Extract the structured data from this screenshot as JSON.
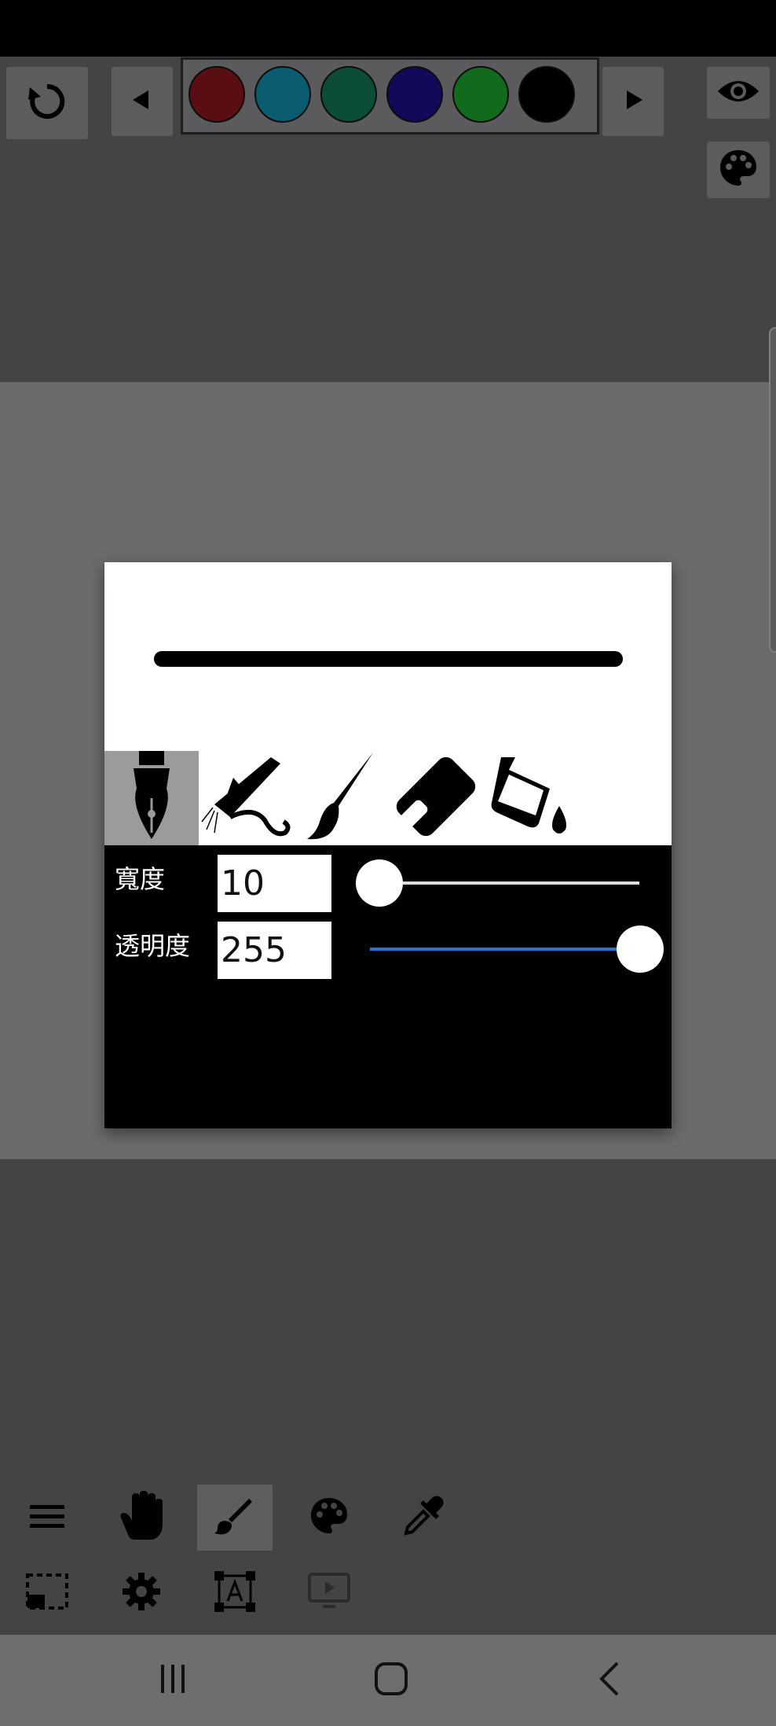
{
  "colors": {
    "status_bar": "#000000",
    "background": "#454346",
    "canvas": "#6b6a6d",
    "accent": "#1f74e0"
  },
  "palette": {
    "swatches": [
      "#5a0d12",
      "#0a5c70",
      "#0b4d38",
      "#12085a",
      "#126a1c",
      "#000000"
    ]
  },
  "top_toolbar": {
    "undo_icon": "undo-icon",
    "prev_icon": "triangle-left-icon",
    "next_icon": "triangle-right-icon",
    "visibility_icon": "eye-icon",
    "palette_icon": "palette-icon"
  },
  "brush_dialog": {
    "tools": [
      {
        "name": "fountain-pen-icon",
        "selected": true
      },
      {
        "name": "airbrush-icon",
        "selected": false
      },
      {
        "name": "paintbrush-icon",
        "selected": false
      },
      {
        "name": "eraser-icon",
        "selected": false
      },
      {
        "name": "fill-bucket-icon",
        "selected": false
      }
    ],
    "width_label": "寬度",
    "width_value": "10",
    "width_slider_fraction": 0.0,
    "opacity_label": "透明度",
    "opacity_value": "255",
    "opacity_slider_fraction": 1.0
  },
  "bottom_toolbar": {
    "row1": [
      "menu-icon",
      "hand-icon",
      "brush-icon",
      "palette-icon",
      "eyedropper-icon"
    ],
    "row2": [
      "selection-icon",
      "gear-icon",
      "text-frame-icon",
      "playback-icon"
    ],
    "active": "brush-icon"
  },
  "system_nav": [
    "recent-apps-icon",
    "home-icon",
    "back-icon"
  ]
}
